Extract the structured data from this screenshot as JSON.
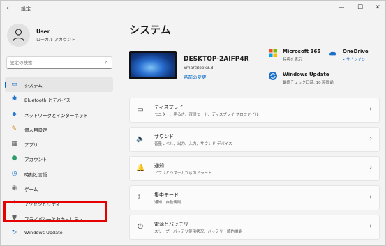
{
  "window": {
    "title": "設定",
    "back_glyph": "←",
    "min_glyph": "—",
    "max_glyph": "☐",
    "close_glyph": "✕"
  },
  "user": {
    "name": "User",
    "account_type": "ローカル アカウント"
  },
  "search": {
    "placeholder": "設定の検索"
  },
  "sidebar": {
    "items": [
      {
        "label": "システム",
        "icon": "▭",
        "icon_name": "system-icon",
        "color": "#1a6fc9"
      },
      {
        "label": "Bluetooth とデバイス",
        "icon": "✱",
        "icon_name": "bluetooth-icon",
        "color": "#1a6fc9"
      },
      {
        "label": "ネットワークとインターネット",
        "icon": "◆",
        "icon_name": "network-icon",
        "color": "#2b7bd6"
      },
      {
        "label": "個人用設定",
        "icon": "✎",
        "icon_name": "personalization-icon",
        "color": "#d08a2b"
      },
      {
        "label": "アプリ",
        "icon": "▦",
        "icon_name": "apps-icon",
        "color": "#555555"
      },
      {
        "label": "アカウント",
        "icon": "●",
        "icon_name": "accounts-icon",
        "color": "#2e9c6b"
      },
      {
        "label": "時刻と言語",
        "icon": "◷",
        "icon_name": "time-language-icon",
        "color": "#2b7bd6"
      },
      {
        "label": "ゲーム",
        "icon": "◉",
        "icon_name": "gaming-icon",
        "color": "#777777"
      },
      {
        "label": "アクセシビリティ",
        "icon": "✦",
        "icon_name": "accessibility-icon",
        "color": "#1a6fc9"
      },
      {
        "label": "プライバシーとセキュリティ",
        "icon": "⛊",
        "icon_name": "privacy-icon",
        "color": "#666666"
      },
      {
        "label": "Windows Update",
        "icon": "↻",
        "icon_name": "windows-update-icon",
        "color": "#1a6fc9"
      }
    ]
  },
  "main": {
    "title": "システム",
    "device": {
      "name": "DESKTOP-2AIFP4R",
      "model": "SmartBook3.8",
      "rename": "名前の変更"
    },
    "quick": [
      {
        "title": "Microsoft 365",
        "sub": "特典を表示"
      },
      {
        "title": "OneDrive",
        "sub": "• サインイン"
      },
      {
        "title": "Windows Update",
        "sub": "最終チェック日時: 10 時間前"
      }
    ],
    "cards": [
      {
        "title": "ディスプレイ",
        "sub": "モニター、明るさ、夜間モード、ディスプレイ プロファイル",
        "icon": "▭",
        "icon_name": "display-icon"
      },
      {
        "title": "サウンド",
        "sub": "音量レベル、出力、入力、サウンド デバイス",
        "icon": "🔈",
        "icon_name": "sound-icon"
      },
      {
        "title": "通知",
        "sub": "アプリとシステムからのアラート",
        "icon": "🔔",
        "icon_name": "notifications-icon"
      },
      {
        "title": "集中モード",
        "sub": "通知、自動規則",
        "icon": "☾",
        "icon_name": "focus-icon"
      },
      {
        "title": "電源とバッテリー",
        "sub": "スリープ、バッテリ使用状況、バッテリー節約機能",
        "icon": "⏻",
        "icon_name": "power-icon"
      }
    ],
    "chevron": "›"
  },
  "colors": {
    "accent": "#0067c0",
    "highlight": "#e60000"
  }
}
